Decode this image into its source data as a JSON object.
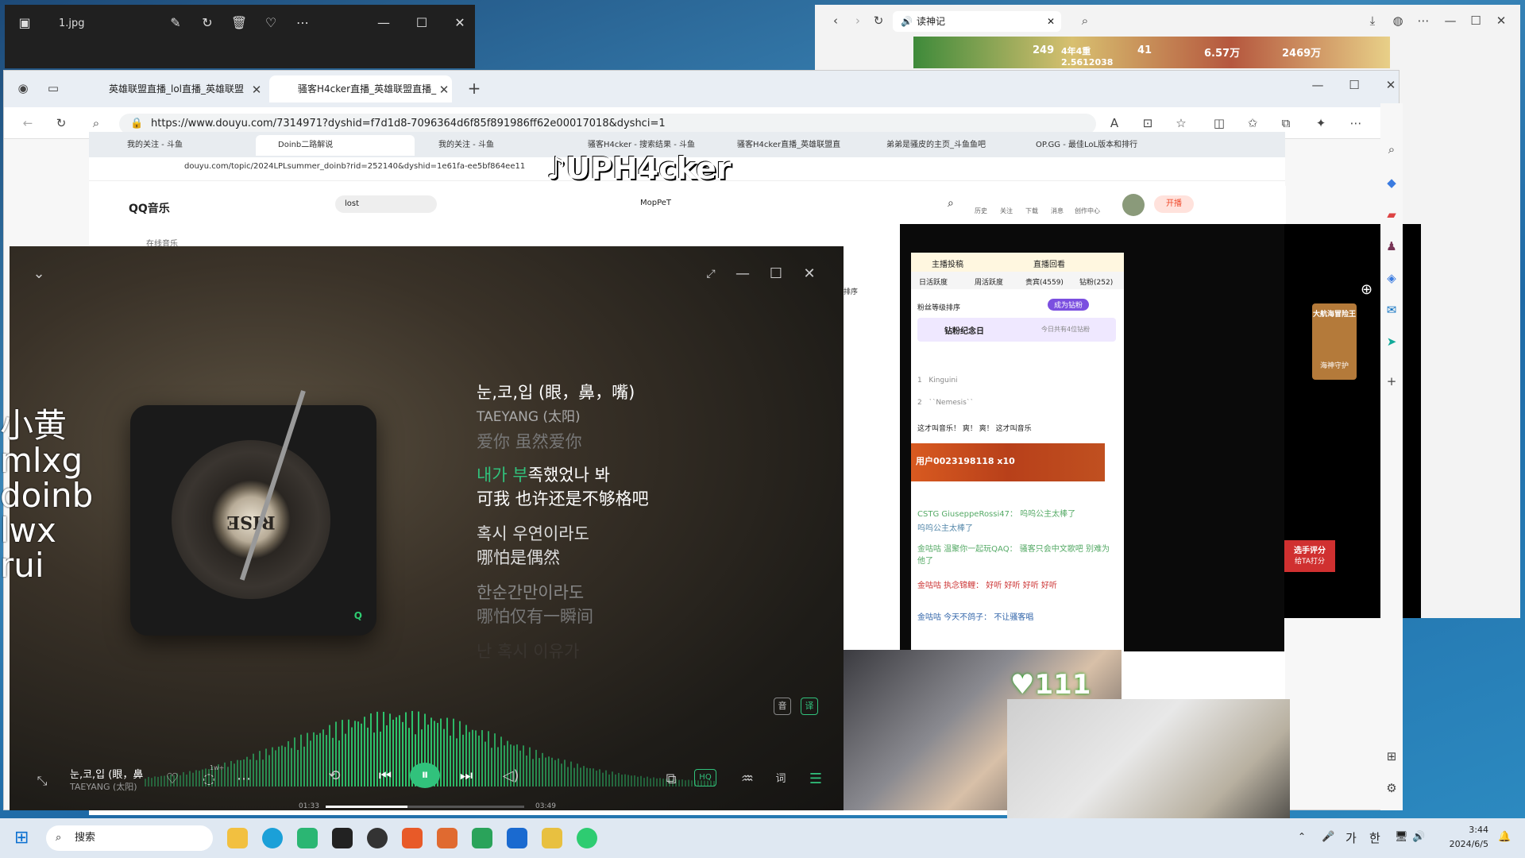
{
  "photo_viewer": {
    "title": "1.jpg"
  },
  "browser_right": {
    "tab": "读神记"
  },
  "game_strip": {
    "v1": "249",
    "v2": "4年4重",
    "v3": "41",
    "v4": "6.57万",
    "v5": "2469万",
    "v6": "2.5612038"
  },
  "edge": {
    "tabs": [
      "英雄联盟直播_lol直播_英雄联盟",
      "骚客H4cker直播_英雄联盟直播_"
    ],
    "url": "https://www.douyu.com/7314971?dyshid=f7d1d8-7096364d6f85f891986ff62e00017018&dyshci=1"
  },
  "inner": {
    "tabs": [
      "我的关注 - 斗鱼",
      "Doinb二路解说",
      "我的关注 - 斗鱼",
      "骚客H4cker - 搜索结果 - 斗鱼",
      "骚客H4cker直播_英雄联盟直",
      "弟弟是骚皮的主页_斗鱼鱼吧",
      "OP.GG - 最佳LoL版本和排行"
    ],
    "url": "douyu.com/topic/2024LPLsummer_doinb?rid=252140&dyshid=1e61fa-ee5bf864ee11",
    "qq_logo": "QQ音乐",
    "qq_search": "lost",
    "qq_user": "MopPeT",
    "qq_side": "在线音乐",
    "qq_sort": "排序"
  },
  "overlay": {
    "tiktok": "UPH4cker",
    "names": [
      "小黄",
      "mlxg",
      "doinb",
      "lwx",
      "rui"
    ]
  },
  "player": {
    "lyrics": [
      {
        "text": "눈,코,입 (眼，鼻，嘴)",
        "kind": "title"
      },
      {
        "text": "TAEYANG (太阳)",
        "kind": "artist"
      },
      {
        "text": "爱你 虽然爱你",
        "kind": "dim"
      },
      {
        "hl": "내가 부",
        "rest": "족했었나 봐",
        "kind": "current"
      },
      {
        "text": "可我 也许还是不够格吧",
        "kind": "current2"
      },
      {
        "text": "혹시 우연이라도",
        "kind": "next"
      },
      {
        "text": "哪怕是偶然",
        "kind": "next"
      },
      {
        "text": "한순간만이라도",
        "kind": "faint"
      },
      {
        "text": "哪怕仅有一瞬间",
        "kind": "faint"
      },
      {
        "text": "난 혹시 이유가",
        "kind": "faint2"
      }
    ],
    "disc_text": "RISE",
    "song": "눈,코,입 (眼，鼻",
    "artist": "TAEYANG (太阳)",
    "time_now": "01:33",
    "time_total": "03:49",
    "progress": 0.41,
    "comment_badge": "1w+",
    "hq": "HQ",
    "btn_yin": "音",
    "btn_yi": "译"
  },
  "douyu": {
    "tabs": [
      "主播投稿",
      "直播回看"
    ],
    "rank_tabs": [
      "日活跃度",
      "周活跃度",
      "贵宾(4559)",
      "钻粉(252)"
    ],
    "fan_rank": "粉丝等级排序",
    "become_fan": "成为钻粉",
    "anniv": "钻粉纪念日",
    "anniv_note": "今日共有4位钻粉",
    "fans": [
      "Kinguini",
      "``Nemesis``"
    ],
    "chat_lines": [
      "这才叫音乐！ 爽！ 爽！ 这才叫音乐",
      "用户0023198118  x10",
      "CSTG GiuseppeRossi47：  呜呜公主太棒了",
      "呜呜公主太棒了",
      "金咕咕 温聚你一起玩QAQ：  骚客只会中文歌吧 别难为他了",
      "金咕咕 执念锦鲤：  好听 好听 好听 好听",
      "金咕咕 今天不鸽子：  不让骚客唱"
    ],
    "header_icons": [
      "历史",
      "关注",
      "下载",
      "消息",
      "创作中心"
    ],
    "live_btn": "开播",
    "cam_count": "111",
    "rate_btn": "选手评分",
    "rate_sub": "给TA打分",
    "sea": "大航海冒险王",
    "sea_sub": "海神守护"
  },
  "taskbar": {
    "search": "搜索",
    "time": "3:44",
    "date": "2024/6/5",
    "ime1": "가",
    "ime2": "한"
  }
}
